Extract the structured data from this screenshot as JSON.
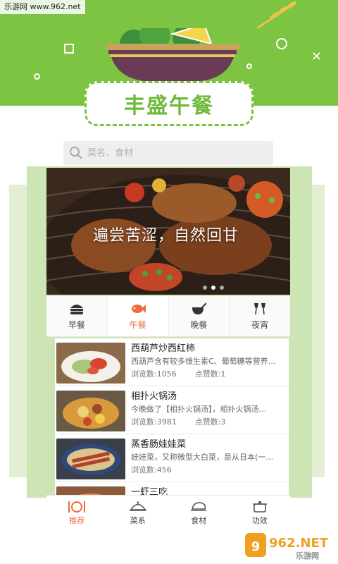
{
  "watermark_top": "乐游网 www.962.net",
  "header": {
    "title": "丰盛午餐"
  },
  "search": {
    "placeholder": "菜名、食材"
  },
  "banner": {
    "caption": "遍尝苦涩，自然回甘"
  },
  "tabs": [
    {
      "label": "早餐",
      "icon": "burger-icon"
    },
    {
      "label": "午餐",
      "icon": "fish-icon",
      "active": true
    },
    {
      "label": "晚餐",
      "icon": "pot-icon"
    },
    {
      "label": "夜宵",
      "icon": "wine-glasses-icon"
    }
  ],
  "recipes": [
    {
      "name": "西葫芦炒西红柿",
      "desc": "西葫芦含有较多维生素C、葡萄糖等营养…",
      "views_label": "浏览数:1056",
      "likes_label": "点赞数:1"
    },
    {
      "name": "相扑火锅汤",
      "desc": "今晚做了【相扑火锅汤】，相扑火锅汤…",
      "views_label": "浏览数:3981",
      "likes_label": "点赞数:3"
    },
    {
      "name": "蒸香肠娃娃菜",
      "desc": "娃娃菜，又称微型大白菜，是从日本(一…",
      "views_label": "浏览数:456",
      "likes_label": ""
    },
    {
      "name": "一虾三吃",
      "desc": "",
      "views_label": "",
      "likes_label": ""
    }
  ],
  "bottom_nav": [
    {
      "label": "推荐",
      "icon": "dining-icon",
      "active": true
    },
    {
      "label": "菜系",
      "icon": "cloche-icon"
    },
    {
      "label": "食材",
      "icon": "chicken-icon"
    },
    {
      "label": "功效",
      "icon": "stew-pot-icon"
    }
  ],
  "watermark_br": {
    "brand": "962.NET",
    "sub": "乐游网"
  },
  "colors": {
    "accent_green": "#7cc442",
    "active_orange": "#ef6a3a"
  }
}
